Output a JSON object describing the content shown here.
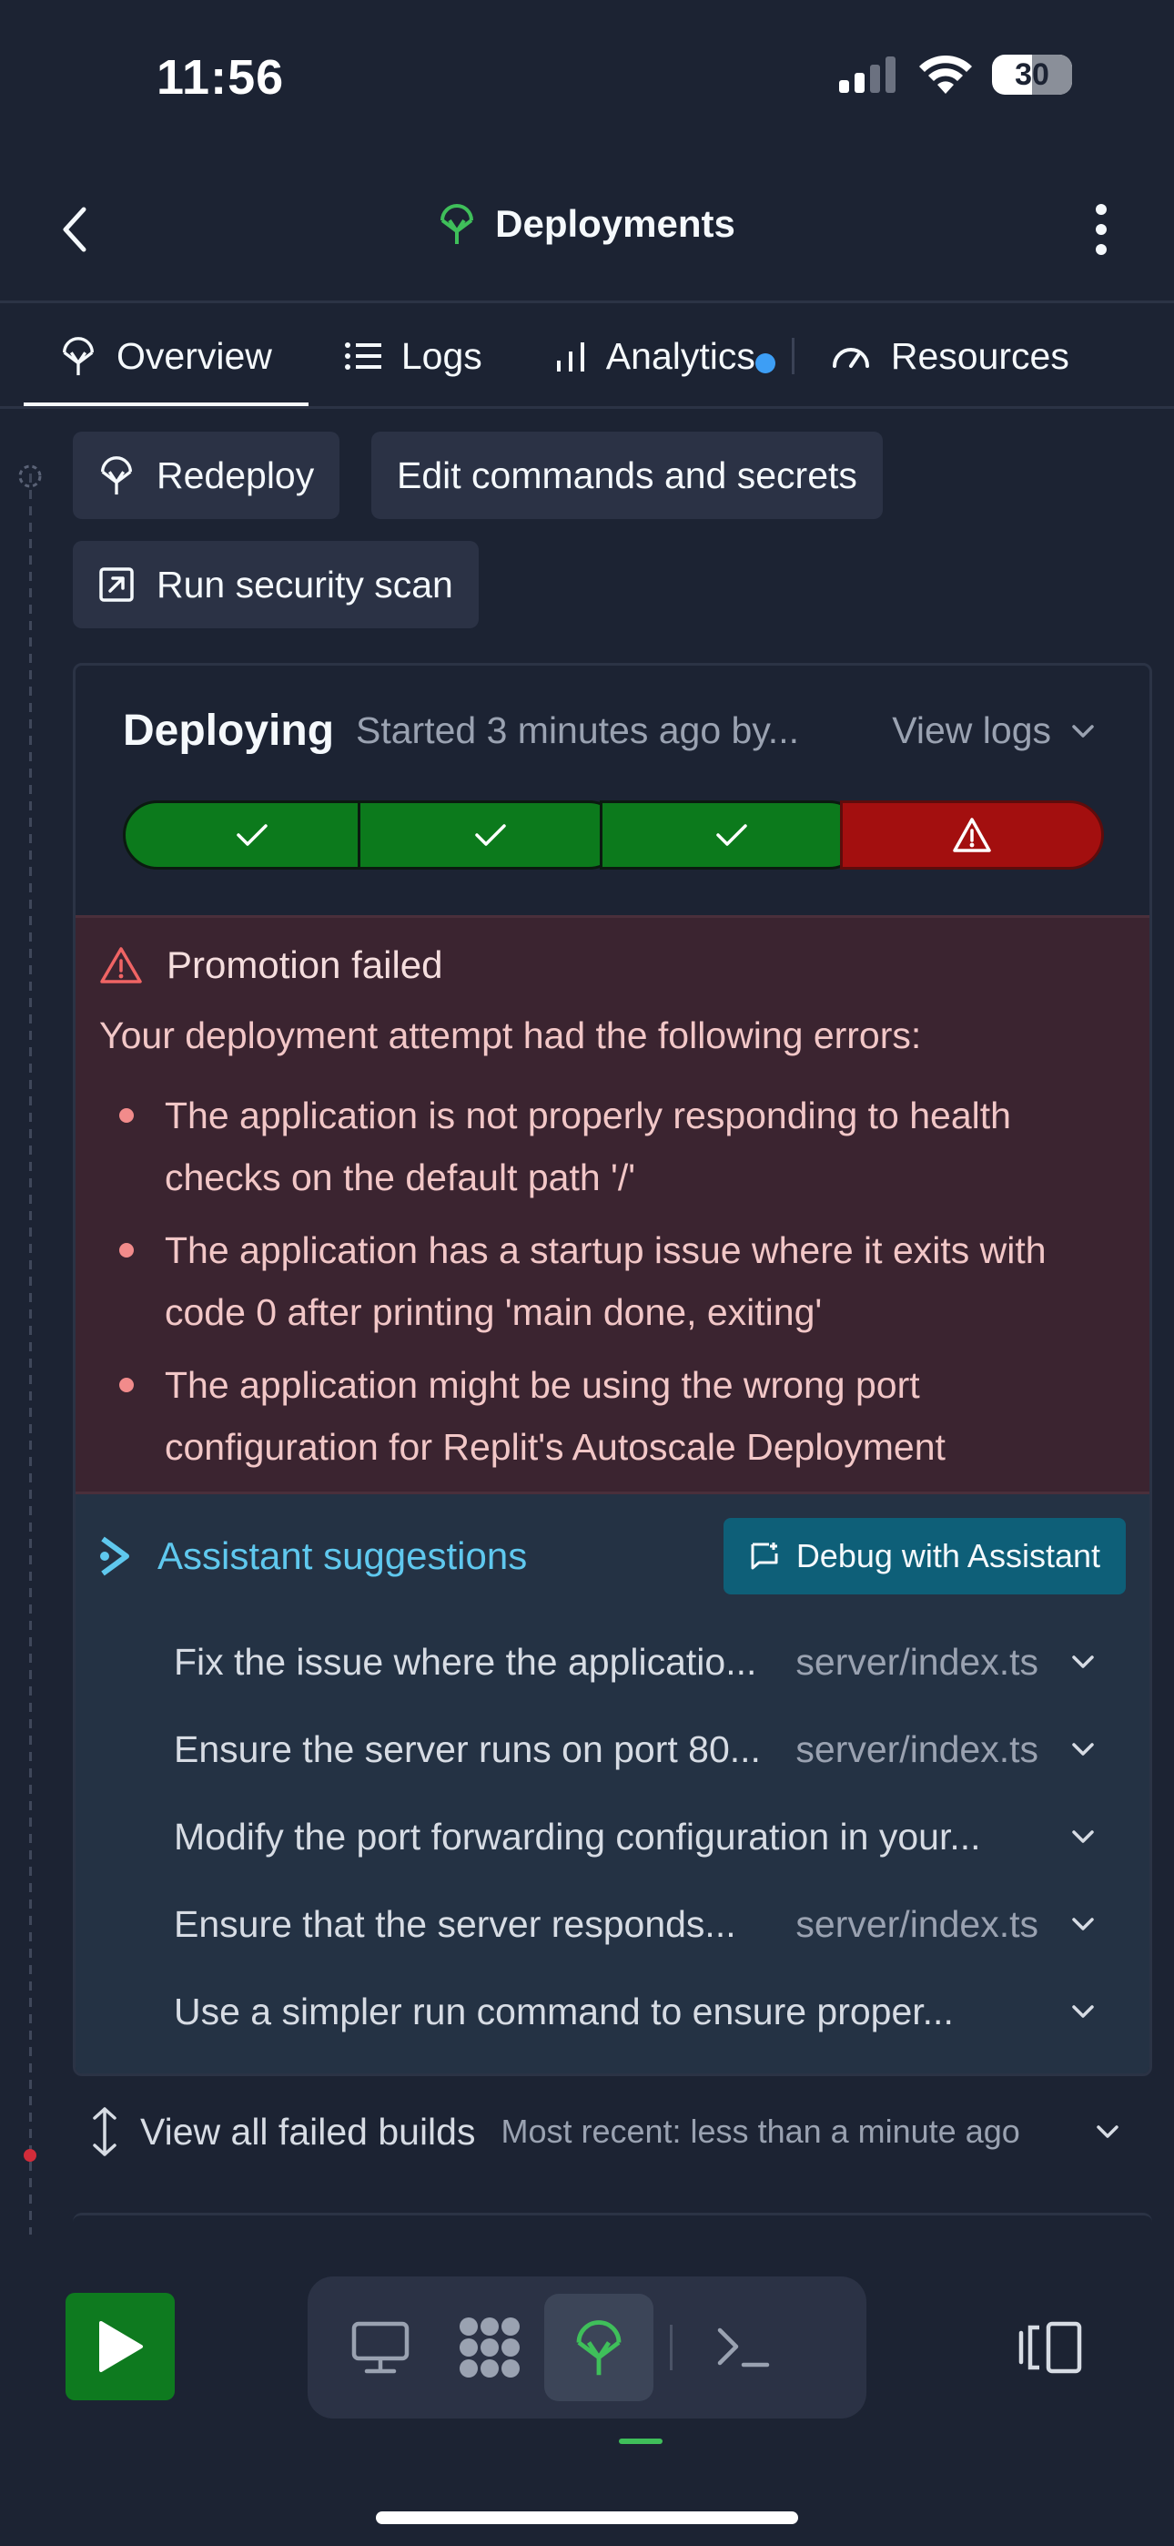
{
  "status_bar": {
    "time": "11:56",
    "battery": "30"
  },
  "header": {
    "title": "Deployments",
    "accent": "#3fbf5a"
  },
  "tabs": [
    {
      "label": "Overview",
      "icon": "deploy-icon",
      "active": true
    },
    {
      "label": "Logs",
      "icon": "list-icon"
    },
    {
      "label": "Analytics",
      "icon": "bar-chart-icon",
      "badge": true
    },
    {
      "label": "Resources",
      "icon": "gauge-icon"
    }
  ],
  "actions": {
    "redeploy": "Redeploy",
    "edit": "Edit commands and secrets",
    "scan": "Run security scan"
  },
  "deploy": {
    "status": "Deploying",
    "started": "Started 3 minutes ago by...",
    "view_logs": "View logs",
    "steps": [
      "success",
      "success",
      "success",
      "error"
    ],
    "colors": {
      "success": "#0c7a1c",
      "error": "#a30f0f"
    }
  },
  "error": {
    "title": "Promotion failed",
    "intro": "Your deployment attempt had the following errors:",
    "items": [
      "The application is not properly responding to health checks on the default path '/'",
      "The application has a startup issue where it exits with code 0 after printing 'main done, exiting'",
      "The application might be using the wrong port configuration for Replit's Autoscale Deployment"
    ]
  },
  "assistant": {
    "title": "Assistant suggestions",
    "debug_button": "Debug with Assistant",
    "suggestions": [
      {
        "text": "Fix the issue where the applicatio...",
        "file": "server/index.ts"
      },
      {
        "text": "Ensure the server runs on port 80...",
        "file": "server/index.ts"
      },
      {
        "text": "Modify the port forwarding configuration in your...",
        "file": ""
      },
      {
        "text": "Ensure that the server responds...",
        "file": "server/index.ts"
      },
      {
        "text": "Use a simpler run command to ensure proper...",
        "file": ""
      }
    ]
  },
  "failed_builds": {
    "label": "View all failed builds",
    "sub": "Most recent: less than a minute ago"
  }
}
